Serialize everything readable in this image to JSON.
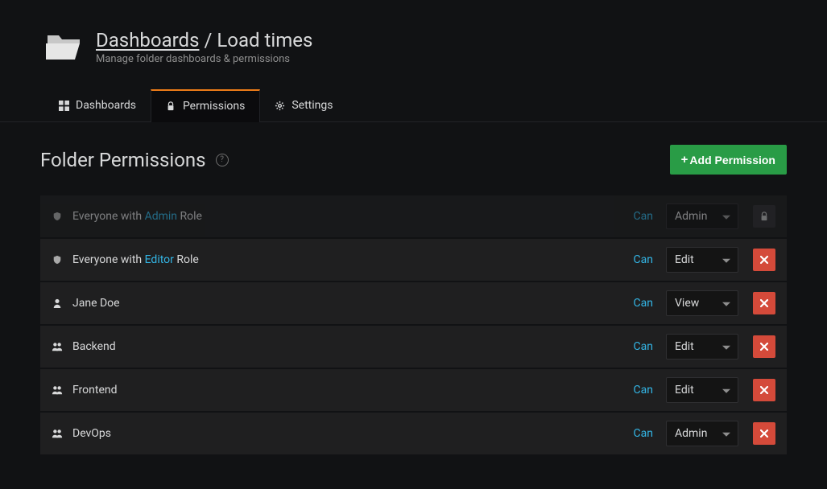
{
  "header": {
    "breadcrumb_root": "Dashboards",
    "breadcrumb_current": "Load times",
    "subtitle": "Manage folder dashboards & permissions"
  },
  "tabs": [
    {
      "label": "Dashboards",
      "icon": "apps"
    },
    {
      "label": "Permissions",
      "icon": "lock"
    },
    {
      "label": "Settings",
      "icon": "gear"
    }
  ],
  "section": {
    "title": "Folder Permissions",
    "add_button": "Add Permission",
    "can_label": "Can"
  },
  "permissions": [
    {
      "icon": "shield",
      "prefix": "Everyone with ",
      "role": "Admin",
      "suffix": " Role",
      "level": "Admin",
      "locked": true
    },
    {
      "icon": "shield",
      "prefix": "Everyone with ",
      "role": "Editor",
      "suffix": " Role",
      "level": "Edit",
      "locked": false
    },
    {
      "icon": "user",
      "prefix": "Jane Doe",
      "role": "",
      "suffix": "",
      "level": "View",
      "locked": false
    },
    {
      "icon": "users",
      "prefix": "Backend",
      "role": "",
      "suffix": "",
      "level": "Edit",
      "locked": false
    },
    {
      "icon": "users",
      "prefix": "Frontend",
      "role": "",
      "suffix": "",
      "level": "Edit",
      "locked": false
    },
    {
      "icon": "users",
      "prefix": "DevOps",
      "role": "",
      "suffix": "",
      "level": "Admin",
      "locked": false
    }
  ]
}
